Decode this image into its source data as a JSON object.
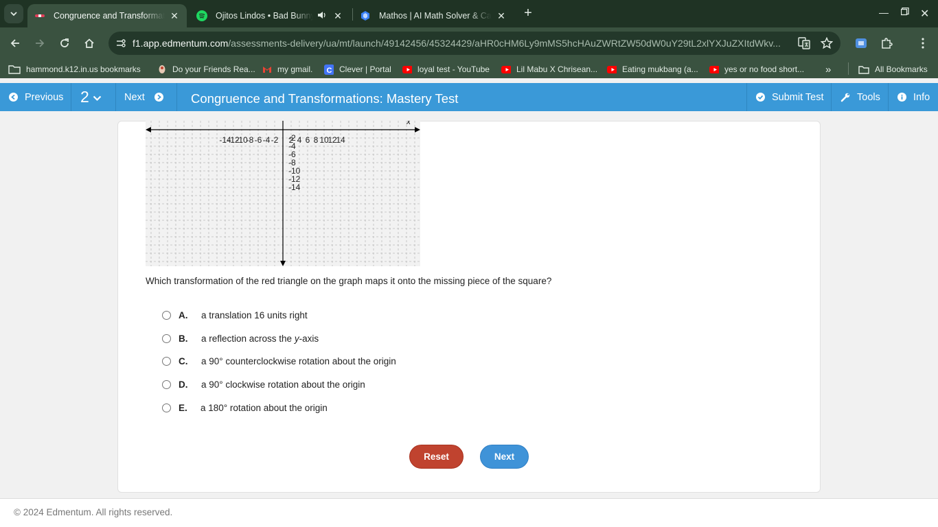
{
  "browser": {
    "tabs": [
      {
        "title": "Congruence and Transformations: Mastery Test",
        "favicon": "edmentum-icon",
        "active": true
      },
      {
        "title": "Ojitos Lindos • Bad Bunny, Bomba Estéreo",
        "favicon": "spotify-icon",
        "active": false
      },
      {
        "title": "Mathos | AI Math Solver & Calculator",
        "favicon": "mathos-icon",
        "active": false
      }
    ],
    "url_host": "f1.app.edmentum.com",
    "url_path": "/assessments-delivery/ua/mt/launch/49142456/45324429/aHR0cHM6Ly9mMS5hcHAuZWRtZW50dW0uY29tL2xlYXJuZXItdWkv...",
    "bookmarks": [
      {
        "label": "hammond.k12.in.us bookmarks",
        "icon": "folder-icon"
      },
      {
        "label": "Do your Friends Rea...",
        "icon": "quiz-icon"
      },
      {
        "label": "my gmail.",
        "icon": "gmail-icon"
      },
      {
        "label": "Clever | Portal",
        "icon": "clever-icon"
      },
      {
        "label": "loyal test - YouTube",
        "icon": "youtube-icon"
      },
      {
        "label": "Lil Mabu X Chrisean...",
        "icon": "youtube-icon"
      },
      {
        "label": "Eating mukbang (a...",
        "icon": "youtube-icon"
      },
      {
        "label": "yes or no food short...",
        "icon": "youtube-icon"
      }
    ],
    "all_bookmarks": "All Bookmarks",
    "more_symbol": "»"
  },
  "app": {
    "previous_label": "Previous",
    "question_number": "2",
    "next_label": "Next",
    "title": "Congruence and Transformations: Mastery Test",
    "submit_label": "Submit Test",
    "tools_label": "Tools",
    "info_label": "Info"
  },
  "graph": {
    "x_axis_label": "x",
    "x_tick_labels": [
      "-14",
      "-12",
      "-10",
      "-8",
      "-6",
      "-4",
      "-2",
      "2",
      "4",
      "6",
      "8",
      "10",
      "12",
      "14"
    ],
    "y_tick_labels": [
      "-2",
      "-4",
      "-6",
      "-8",
      "-10",
      "-12",
      "-14"
    ]
  },
  "question": {
    "text": "Which transformation of the red triangle on the graph maps it onto the missing piece of the square?",
    "options": [
      {
        "letter": "A.",
        "text": "a translation 16 units right"
      },
      {
        "letter": "B.",
        "text_before": "a reflection across the ",
        "text_italic": "y",
        "text_after": "-axis"
      },
      {
        "letter": "C.",
        "text": "a 90° counterclockwise rotation about the origin"
      },
      {
        "letter": "D.",
        "text": "a 90° clockwise rotation about the origin"
      },
      {
        "letter": "E.",
        "text": "a 180° rotation about the origin"
      }
    ],
    "reset_label": "Reset",
    "next_label": "Next"
  },
  "footer": {
    "copyright": "© 2024 Edmentum. All rights reserved."
  }
}
